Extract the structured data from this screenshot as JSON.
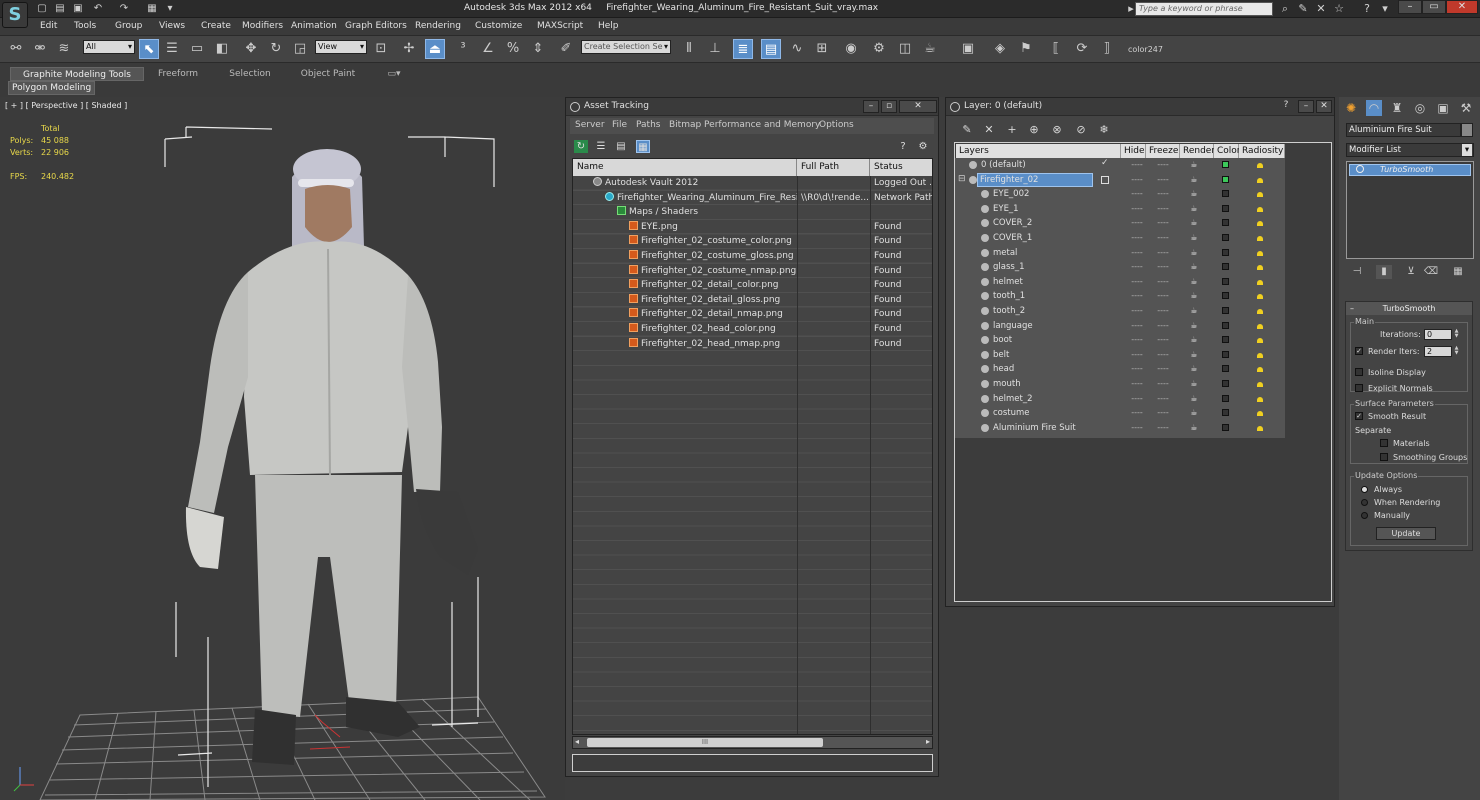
{
  "app": {
    "title": "Autodesk 3ds Max 2012 x64",
    "file": "Firefighter_Wearing_Aluminum_Fire_Resistant_Suit_vray.max",
    "search_placeholder": "Type a keyword or phrase"
  },
  "menu": [
    "Edit",
    "Tools",
    "Group",
    "Views",
    "Create",
    "Modifiers",
    "Animation",
    "Graph Editors",
    "Rendering",
    "Customize",
    "MAXScript",
    "Help"
  ],
  "toolbar": {
    "filter": "All",
    "ref_coord": "View",
    "selection_set_placeholder": "Create Selection Se",
    "color_label": "color247"
  },
  "ribbon": {
    "tabs": [
      "Graphite Modeling Tools",
      "Freeform",
      "Selection",
      "Object Paint"
    ],
    "subtab": "Polygon Modeling"
  },
  "viewport": {
    "label": "[ + ] [ Perspective ] [ Shaded ]",
    "stats_header": "Total",
    "polys_label": "Polys:",
    "polys_value": "45 088",
    "verts_label": "Verts:",
    "verts_value": "22 906",
    "fps_label": "FPS:",
    "fps_value": "240.482"
  },
  "asset_tracking": {
    "title": "Asset Tracking",
    "menu": [
      "Server",
      "File",
      "Paths",
      "Bitmap Performance and Memory",
      "Options"
    ],
    "columns": [
      "Name",
      "Full Path",
      "Status"
    ],
    "rows": [
      {
        "name": "Autodesk Vault 2012",
        "path": "",
        "status": "Logged Out ...",
        "indent": 1
      },
      {
        "name": "Firefighter_Wearing_Aluminum_Fire_Resis...",
        "path": "\\\\R0\\d\\!rende...",
        "status": "Network Path",
        "indent": 2
      },
      {
        "name": "Maps / Shaders",
        "path": "",
        "status": "",
        "indent": 3
      },
      {
        "name": "EYE.png",
        "path": "",
        "status": "Found",
        "indent": 4
      },
      {
        "name": "Firefighter_02_costume_color.png",
        "path": "",
        "status": "Found",
        "indent": 4
      },
      {
        "name": "Firefighter_02_costume_gloss.png",
        "path": "",
        "status": "Found",
        "indent": 4
      },
      {
        "name": "Firefighter_02_costume_nmap.png",
        "path": "",
        "status": "Found",
        "indent": 4
      },
      {
        "name": "Firefighter_02_detail_color.png",
        "path": "",
        "status": "Found",
        "indent": 4
      },
      {
        "name": "Firefighter_02_detail_gloss.png",
        "path": "",
        "status": "Found",
        "indent": 4
      },
      {
        "name": "Firefighter_02_detail_nmap.png",
        "path": "",
        "status": "Found",
        "indent": 4
      },
      {
        "name": "Firefighter_02_head_color.png",
        "path": "",
        "status": "Found",
        "indent": 4
      },
      {
        "name": "Firefighter_02_head_nmap.png",
        "path": "",
        "status": "Found",
        "indent": 4
      }
    ],
    "scroll_grip": "III"
  },
  "layer_window": {
    "title": "Layer: 0 (default)",
    "columns": [
      "Layers",
      "Hide",
      "Freeze",
      "Render",
      "Color",
      "Radiosity"
    ],
    "layers": [
      {
        "name": "0 (default)",
        "level": 0,
        "color": "#3cc85a",
        "check": "✓"
      },
      {
        "name": "Firefighter_02",
        "level": 0,
        "color": "#3cc85a",
        "selected": true
      },
      {
        "name": "EYE_002",
        "level": 1
      },
      {
        "name": "EYE_1",
        "level": 1
      },
      {
        "name": "COVER_2",
        "level": 1
      },
      {
        "name": "COVER_1",
        "level": 1
      },
      {
        "name": "metal",
        "level": 1
      },
      {
        "name": "glass_1",
        "level": 1
      },
      {
        "name": "helmet",
        "level": 1
      },
      {
        "name": "tooth_1",
        "level": 1
      },
      {
        "name": "tooth_2",
        "level": 1
      },
      {
        "name": "language",
        "level": 1
      },
      {
        "name": "boot",
        "level": 1
      },
      {
        "name": "belt",
        "level": 1
      },
      {
        "name": "head",
        "level": 1
      },
      {
        "name": "mouth",
        "level": 1
      },
      {
        "name": "helmet_2",
        "level": 1
      },
      {
        "name": "costume",
        "level": 1
      },
      {
        "name": "Aluminium Fire Suit",
        "level": 1
      }
    ],
    "dash": "----"
  },
  "command_panel": {
    "object_name": "Aluminium Fire Suit",
    "modifier_list": "Modifier List",
    "stack_item": "TurboSmooth",
    "rollout_title": "TurboSmooth",
    "main_label": "Main",
    "iterations_label": "Iterations:",
    "iterations_value": "0",
    "render_iters_label": "Render Iters:",
    "render_iters_value": "2",
    "isoline_label": "Isoline Display",
    "explicit_normals_label": "Explicit Normals",
    "surface_params_label": "Surface Parameters",
    "smooth_result_label": "Smooth Result",
    "separate_label": "Separate",
    "materials_label": "Materials",
    "smoothing_groups_label": "Smoothing Groups",
    "update_options_label": "Update Options",
    "always_label": "Always",
    "when_rendering_label": "When Rendering",
    "manually_label": "Manually",
    "update_button": "Update"
  },
  "colors": {
    "accent": "#5a8ec8",
    "stats_yellow": "#e8d84a",
    "layer_green": "#3cc85a"
  }
}
